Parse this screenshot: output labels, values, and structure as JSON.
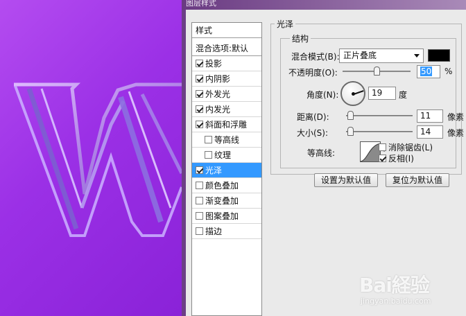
{
  "dialog": {
    "title": "图层样式"
  },
  "styles_panel": {
    "header": "样式",
    "blend_default": "混合选项:默认",
    "items": [
      {
        "label": "投影",
        "checked": true
      },
      {
        "label": "内阴影",
        "checked": true
      },
      {
        "label": "外发光",
        "checked": true
      },
      {
        "label": "内发光",
        "checked": true
      },
      {
        "label": "斜面和浮雕",
        "checked": true
      },
      {
        "label": "等高线",
        "checked": false
      },
      {
        "label": "纹理",
        "checked": false
      },
      {
        "label": "光泽",
        "checked": true,
        "selected": true
      },
      {
        "label": "颜色叠加",
        "checked": false
      },
      {
        "label": "渐变叠加",
        "checked": false
      },
      {
        "label": "图案叠加",
        "checked": false
      },
      {
        "label": "描边",
        "checked": false
      }
    ]
  },
  "gloss": {
    "section_title": "光泽",
    "group_title": "结构",
    "blend_mode_label": "混合模式(B):",
    "blend_mode_value": "正片叠底",
    "blend_color": "#000000",
    "opacity_label": "不透明度(O):",
    "opacity_value": "50",
    "opacity_unit": "%",
    "angle_label": "角度(N):",
    "angle_value": "19",
    "angle_unit": "度",
    "distance_label": "距离(D):",
    "distance_value": "11",
    "distance_unit": "像素",
    "size_label": "大小(S):",
    "size_value": "14",
    "size_unit": "像素",
    "contour_label": "等高线:",
    "antialias_label": "消除锯齿(L)",
    "antialias_checked": false,
    "invert_label": "反相(I)",
    "invert_checked": true,
    "btn_set_default": "设置为默认值",
    "btn_reset_default": "复位为默认值"
  },
  "canvas": {
    "letter": "W",
    "background_color": "#9b30e6"
  },
  "watermark": {
    "brand": "Bai経验",
    "site": "jingyan.baidu.com"
  }
}
